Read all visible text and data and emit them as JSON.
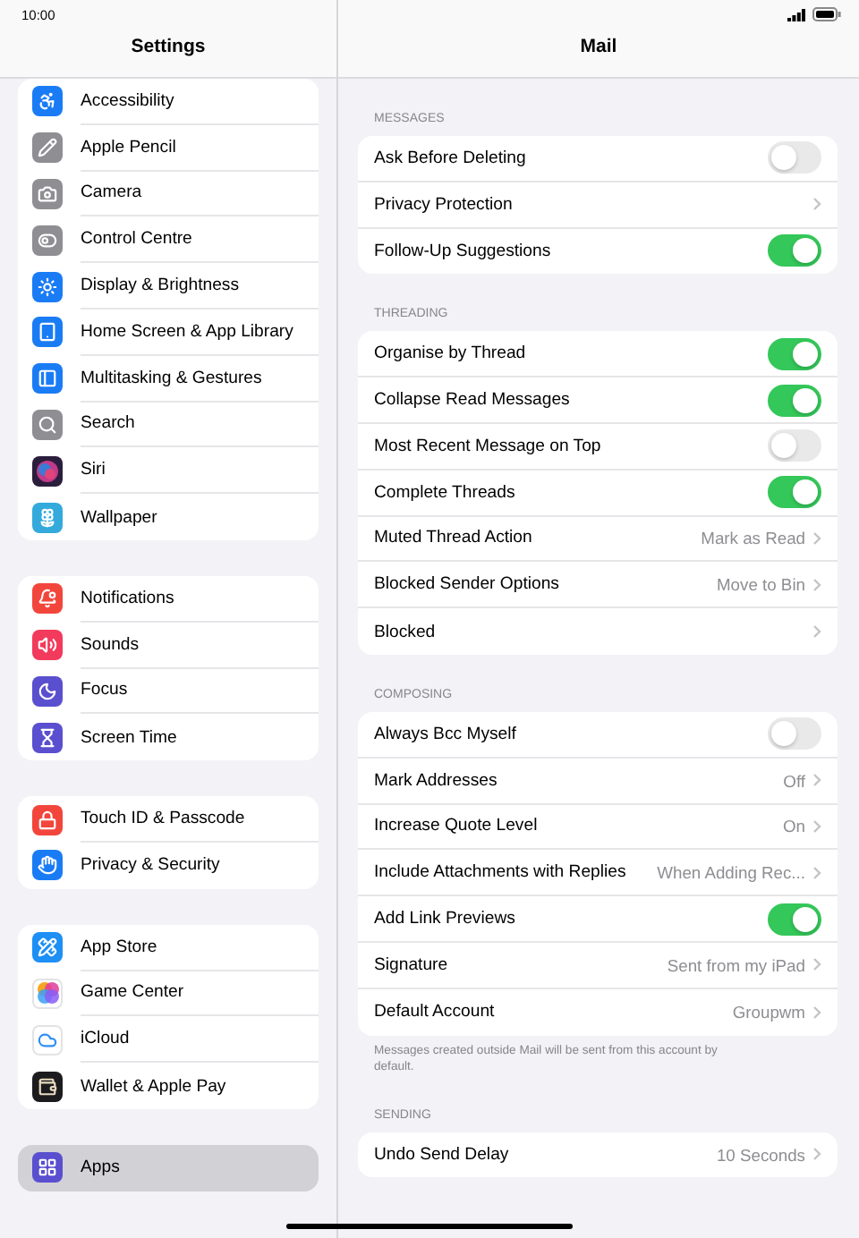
{
  "status_bar": {
    "time": "10:00"
  },
  "sidebar": {
    "title": "Settings",
    "groups": [
      {
        "items": [
          {
            "label": "Accessibility",
            "kind": "accessibility",
            "color": "#1a7cf5",
            "selected": false
          },
          {
            "label": "Apple Pencil",
            "kind": "pencil",
            "color": "#8e8e93",
            "selected": false
          },
          {
            "label": "Camera",
            "kind": "camera",
            "color": "#8e8e93",
            "selected": false
          },
          {
            "label": "Control Centre",
            "kind": "toggles",
            "color": "#8e8e93",
            "selected": false
          },
          {
            "label": "Display & Brightness",
            "kind": "sun",
            "color": "#1a7cf5",
            "selected": false
          },
          {
            "label": "Home Screen & App Library",
            "kind": "tablet",
            "color": "#1a7cf5",
            "selected": false
          },
          {
            "label": "Multitasking & Gestures",
            "kind": "panels",
            "color": "#1a7cf5",
            "selected": false
          },
          {
            "label": "Search",
            "kind": "search",
            "color": "#8e8e93",
            "selected": false
          },
          {
            "label": "Siri",
            "kind": "orb",
            "color": "#2b1e3c",
            "selected": false
          },
          {
            "label": "Wallpaper",
            "kind": "flower",
            "color": "#34aadc",
            "selected": false
          }
        ]
      },
      {
        "items": [
          {
            "label": "Notifications",
            "kind": "bell",
            "color": "#f2463c",
            "selected": false
          },
          {
            "label": "Sounds",
            "kind": "speaker",
            "color": "#f23a5c",
            "selected": false
          },
          {
            "label": "Focus",
            "kind": "moon",
            "color": "#5a4fcf",
            "selected": false
          },
          {
            "label": "Screen Time",
            "kind": "hourglass",
            "color": "#5a4fcf",
            "selected": false
          }
        ]
      },
      {
        "items": [
          {
            "label": "Touch ID & Passcode",
            "kind": "lock",
            "color": "#f2463c",
            "selected": false
          },
          {
            "label": "Privacy & Security",
            "kind": "hand",
            "color": "#1a7cf5",
            "selected": false
          }
        ]
      },
      {
        "items": [
          {
            "label": "App Store",
            "kind": "store",
            "color": "#1d8ff5",
            "selected": false
          },
          {
            "label": "Game Center",
            "kind": "bubbles",
            "color": "#ffffff",
            "selected": false
          },
          {
            "label": "iCloud",
            "kind": "cloud",
            "color": "#ffffff",
            "selected": false
          },
          {
            "label": "Wallet & Apple Pay",
            "kind": "wallet",
            "color": "#1c1c1e",
            "selected": false
          }
        ]
      },
      {
        "items": [
          {
            "label": "Apps",
            "kind": "grid",
            "color": "#5a4fcf",
            "selected": true
          }
        ]
      }
    ]
  },
  "detail": {
    "title": "Mail",
    "sections": [
      {
        "header": "MESSAGES",
        "rows": [
          {
            "label": "Ask Before Deleting",
            "kind": "toggle",
            "on": false
          },
          {
            "label": "Privacy Protection",
            "kind": "link"
          },
          {
            "label": "Follow-Up Suggestions",
            "kind": "toggle",
            "on": true
          }
        ]
      },
      {
        "header": "THREADING",
        "rows": [
          {
            "label": "Organise by Thread",
            "kind": "toggle",
            "on": true
          },
          {
            "label": "Collapse Read Messages",
            "kind": "toggle",
            "on": true
          },
          {
            "label": "Most Recent Message on Top",
            "kind": "toggle",
            "on": false
          },
          {
            "label": "Complete Threads",
            "kind": "toggle",
            "on": true
          },
          {
            "label": "Muted Thread Action",
            "kind": "link",
            "value": "Mark as Read"
          },
          {
            "label": "Blocked Sender Options",
            "kind": "link",
            "value": "Move to Bin"
          },
          {
            "label": "Blocked",
            "kind": "link"
          }
        ]
      },
      {
        "header": "COMPOSING",
        "rows": [
          {
            "label": "Always Bcc Myself",
            "kind": "toggle",
            "on": false
          },
          {
            "label": "Mark Addresses",
            "kind": "link",
            "value": "Off"
          },
          {
            "label": "Increase Quote Level",
            "kind": "link",
            "value": "On"
          },
          {
            "label": "Include Attachments with Replies",
            "kind": "link",
            "value": "When Adding Rec..."
          },
          {
            "label": "Add Link Previews",
            "kind": "toggle",
            "on": true
          },
          {
            "label": "Signature",
            "kind": "link",
            "value": "Sent from my iPad"
          },
          {
            "label": "Default Account",
            "kind": "link",
            "value": "Groupwm"
          }
        ],
        "footer": "Messages created outside Mail will be sent from this account by default."
      },
      {
        "header": "SENDING",
        "rows": [
          {
            "label": "Undo Send Delay",
            "kind": "link",
            "value": "10 Seconds"
          }
        ]
      }
    ]
  }
}
